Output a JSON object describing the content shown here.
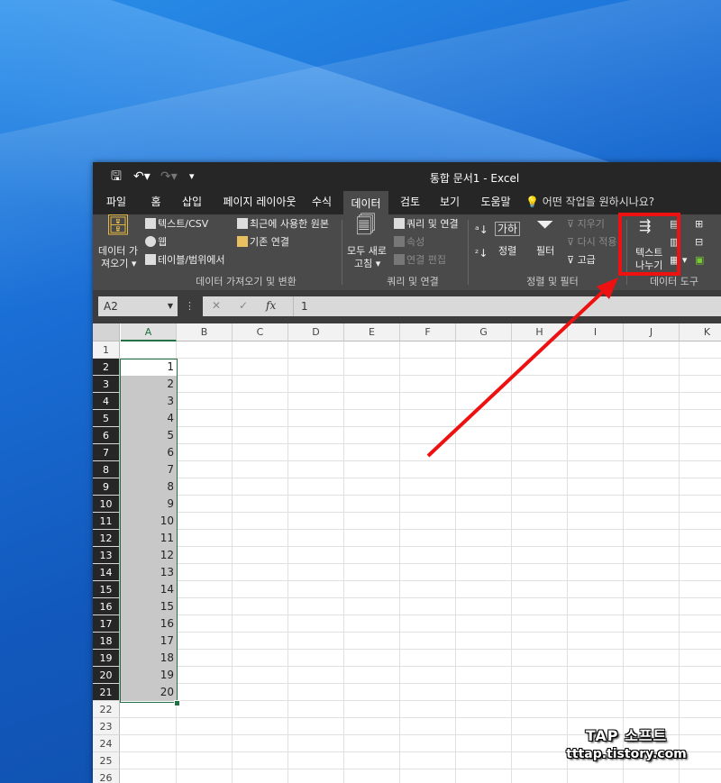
{
  "window": {
    "title": "통합 문서1  -  Excel"
  },
  "tabs": [
    {
      "label": "파일"
    },
    {
      "label": "홈"
    },
    {
      "label": "삽입"
    },
    {
      "label": "페이지 레이아웃"
    },
    {
      "label": "수식"
    },
    {
      "label": "데이터"
    },
    {
      "label": "검토"
    },
    {
      "label": "보기"
    },
    {
      "label": "도움말"
    }
  ],
  "tellme": "어떤 작업을 원하시나요?",
  "ribbon": {
    "get_data_l1": "데이터 가",
    "get_data_l2": "져오기",
    "from_text_csv": "텍스트/CSV",
    "web": "웹",
    "from_table": "테이블/범위에서",
    "recent_sources": "최근에 사용한 원본",
    "existing_connections": "기존 연결",
    "group_get_transform": "데이터 가져오기 및 변환",
    "refresh_all_l1": "모두 새로",
    "refresh_all_l2": "고침",
    "queries_connections": "쿼리 및 연결",
    "properties": "속성",
    "edit_links": "연결 편집",
    "group_queries": "쿼리 및 연결",
    "sort": "정렬",
    "filter": "필터",
    "clear": "지우기",
    "reapply": "다시 적용",
    "advanced": "고급",
    "group_sort_filter": "정렬 및 필터",
    "text_to_columns_l1": "텍스트",
    "text_to_columns_l2": "나누기",
    "group_data_tools": "데이터 도구"
  },
  "formula_bar": {
    "name_box": "A2",
    "value": "1"
  },
  "grid": {
    "columns": [
      "A",
      "B",
      "C",
      "D",
      "E",
      "F",
      "G",
      "H",
      "I",
      "J",
      "K"
    ],
    "rows": [
      "1",
      "2",
      "3",
      "4",
      "5",
      "6",
      "7",
      "8",
      "9",
      "10",
      "11",
      "12",
      "13",
      "14",
      "15",
      "16",
      "17",
      "18",
      "19",
      "20",
      "21",
      "22",
      "23",
      "24",
      "25",
      "26"
    ],
    "col_a_values": [
      "",
      "1",
      "2",
      "3",
      "4",
      "5",
      "6",
      "7",
      "8",
      "9",
      "10",
      "11",
      "12",
      "13",
      "14",
      "15",
      "16",
      "17",
      "18",
      "19",
      "20"
    ]
  },
  "watermark": {
    "line1": "TAP 소프트",
    "line2": "tttap.tistory.com"
  },
  "colors": {
    "highlight": "#ee1111",
    "selection": "#217346",
    "titlebar": "#262626",
    "ribbon": "#4a4a4a"
  }
}
